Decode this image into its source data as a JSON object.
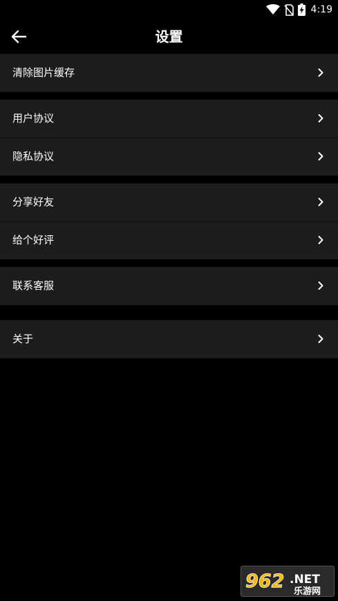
{
  "status_bar": {
    "time": "4:19",
    "icons": [
      "wifi-icon",
      "no-sim-icon",
      "battery-charging-icon"
    ]
  },
  "header": {
    "title": "设置",
    "back_icon": "arrow-left-icon"
  },
  "settings": {
    "groups": [
      {
        "items": [
          {
            "label": "清除图片缓存"
          }
        ]
      },
      {
        "items": [
          {
            "label": "用户协议"
          },
          {
            "label": "隐私协议"
          }
        ]
      },
      {
        "items": [
          {
            "label": "分享好友"
          },
          {
            "label": "给个好评"
          }
        ]
      },
      {
        "items": [
          {
            "label": "联系客服"
          }
        ]
      },
      {
        "items": [
          {
            "label": "关于"
          }
        ]
      }
    ],
    "chevron_icon": "chevron-right-icon"
  },
  "watermark": {
    "brand": "962.NET",
    "subtitle": "乐游网"
  },
  "colors": {
    "background": "#000000",
    "row_background": "#1c1c1c",
    "text": "#ffffff"
  }
}
